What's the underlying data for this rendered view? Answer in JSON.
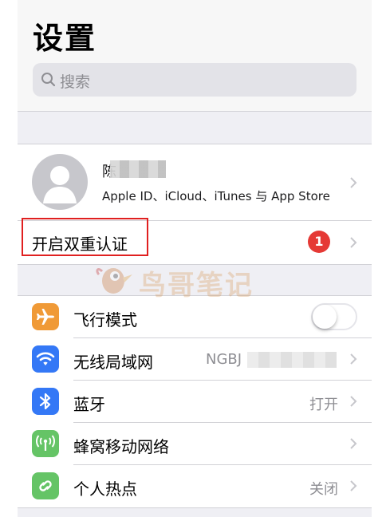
{
  "header": {
    "title": "设置",
    "search_placeholder": "搜索"
  },
  "account": {
    "name": "陈",
    "subtitle": "Apple ID、iCloud、iTunes 与 App Store"
  },
  "two_factor": {
    "label": "开启双重认证",
    "badge_count": "1"
  },
  "watermark": {
    "text": "鸟哥笔记"
  },
  "settings": [
    {
      "label": "飞行模式",
      "icon": "airplane-icon",
      "color": "#f09a37",
      "value": "",
      "toggle_on": false
    },
    {
      "label": "无线局域网",
      "icon": "wifi-icon",
      "color": "#3478f6",
      "value": "NGBJ"
    },
    {
      "label": "蓝牙",
      "icon": "bluetooth-icon",
      "color": "#3478f6",
      "value": "打开"
    },
    {
      "label": "蜂窝移动网络",
      "icon": "cellular-icon",
      "color": "#65c466",
      "value": ""
    },
    {
      "label": "个人热点",
      "icon": "hotspot-icon",
      "color": "#65c466",
      "value": "关闭"
    }
  ]
}
